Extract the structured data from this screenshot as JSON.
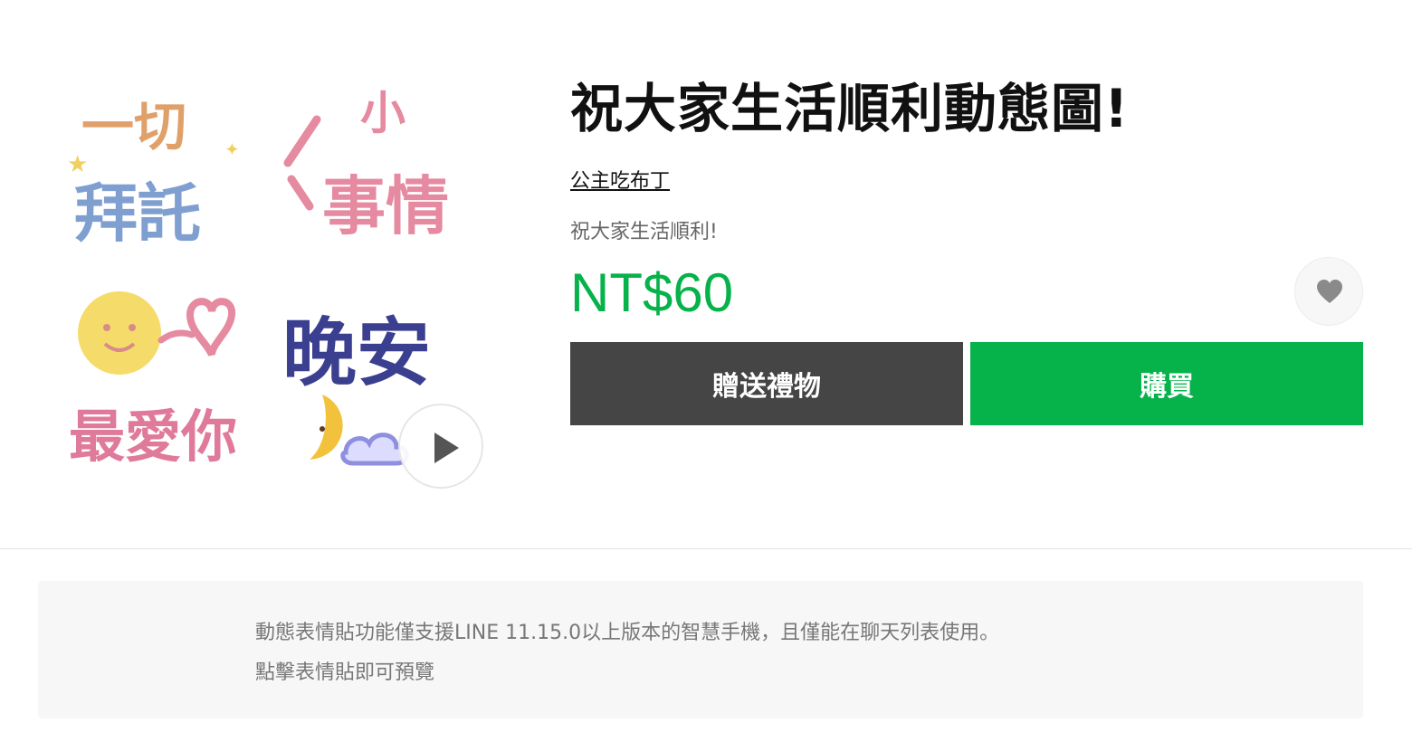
{
  "product": {
    "title": "祝大家生活順利動態圖!",
    "author": "公主吃布丁",
    "description": "祝大家生活順利!",
    "price": "NT$60"
  },
  "actions": {
    "gift_label": "贈送禮物",
    "buy_label": "購買"
  },
  "preview": {
    "stickers": [
      {
        "line1": "一切",
        "line2": "拜託"
      },
      {
        "line1": "小",
        "line2": "事情"
      },
      {
        "line1": "",
        "line2": "最愛你"
      },
      {
        "line1": "晚安",
        "line2": ""
      }
    ]
  },
  "notice": {
    "line1": "動態表情貼功能僅支援LINE 11.15.0以上版本的智慧手機，且僅能在聊天列表使用。",
    "line2": "點擊表情貼即可預覽"
  },
  "colors": {
    "accent_green": "#06b24a",
    "gift_button": "#454545",
    "sticker_orange": "#e0a06a",
    "sticker_blue": "#7f9fd0",
    "sticker_pink": "#e58aa0",
    "sticker_navy": "#3b3f8f",
    "sticker_yellow": "#f3c23c"
  },
  "icons": {
    "play": "play-icon",
    "favorite": "heart-icon"
  }
}
